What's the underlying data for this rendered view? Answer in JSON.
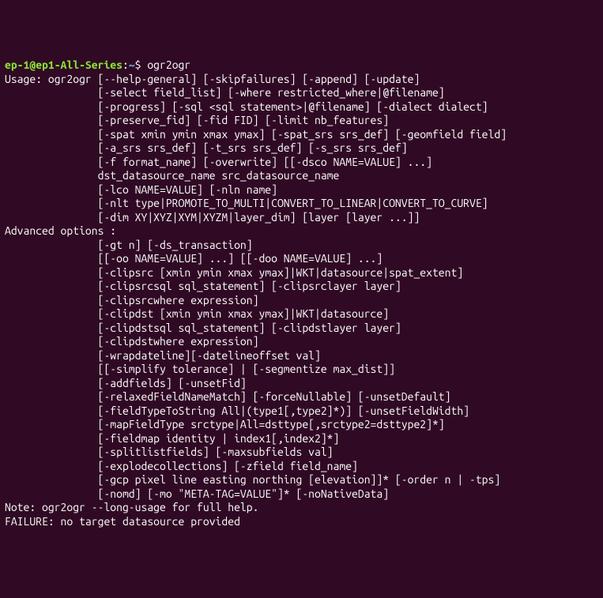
{
  "prompt": {
    "user_host": "ep-1@ep1-All-Series",
    "colon": ":",
    "path": "~",
    "dollar": "$ ",
    "command": "ogr2ogr"
  },
  "output_lines": [
    "Usage: ogr2ogr [--help-general] [-skipfailures] [-append] [-update]",
    "               [-select field_list] [-where restricted_where|@filename]",
    "               [-progress] [-sql <sql statement>|@filename] [-dialect dialect]",
    "               [-preserve_fid] [-fid FID] [-limit nb_features]",
    "               [-spat xmin ymin xmax ymax] [-spat_srs srs_def] [-geomfield field]",
    "               [-a_srs srs_def] [-t_srs srs_def] [-s_srs srs_def]",
    "               [-f format_name] [-overwrite] [[-dsco NAME=VALUE] ...]",
    "               dst_datasource_name src_datasource_name",
    "               [-lco NAME=VALUE] [-nln name]",
    "               [-nlt type|PROMOTE_TO_MULTI|CONVERT_TO_LINEAR|CONVERT_TO_CURVE]",
    "               [-dim XY|XYZ|XYM|XYZM|layer_dim] [layer [layer ...]]",
    "",
    "Advanced options :",
    "               [-gt n] [-ds_transaction]",
    "               [[-oo NAME=VALUE] ...] [[-doo NAME=VALUE] ...]",
    "               [-clipsrc [xmin ymin xmax ymax]|WKT|datasource|spat_extent]",
    "               [-clipsrcsql sql_statement] [-clipsrclayer layer]",
    "               [-clipsrcwhere expression]",
    "               [-clipdst [xmin ymin xmax ymax]|WKT|datasource]",
    "               [-clipdstsql sql_statement] [-clipdstlayer layer]",
    "               [-clipdstwhere expression]",
    "               [-wrapdateline][-datelineoffset val]",
    "               [[-simplify tolerance] | [-segmentize max_dist]]",
    "               [-addfields] [-unsetFid]",
    "               [-relaxedFieldNameMatch] [-forceNullable] [-unsetDefault]",
    "               [-fieldTypeToString All|(type1[,type2]*)] [-unsetFieldWidth]",
    "               [-mapFieldType srctype|All=dsttype[,srctype2=dsttype2]*]",
    "               [-fieldmap identity | index1[,index2]*]",
    "               [-splitlistfields] [-maxsubfields val]",
    "               [-explodecollections] [-zfield field_name]",
    "               [-gcp pixel line easting northing [elevation]]* [-order n | -tps]",
    "               [-nomd] [-mo \"META-TAG=VALUE\"]* [-noNativeData]",
    "",
    "Note: ogr2ogr --long-usage for full help.",
    "",
    "FAILURE: no target datasource provided"
  ]
}
